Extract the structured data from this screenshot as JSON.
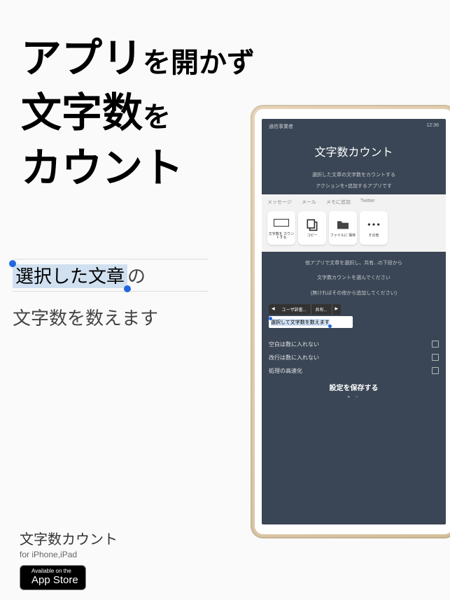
{
  "headline": {
    "l1_big": "アプリ",
    "l1_med": "を開かず",
    "l2_big": "文字数",
    "l2_med": "を",
    "l3_big": "カウント"
  },
  "selection": {
    "highlighted": "選択した文章",
    "after": "の",
    "line2": "文字数を数えます"
  },
  "tablet": {
    "status_left": "通信事業者",
    "status_right": "12:36",
    "title": "文字数カウント",
    "desc1": "選択した文章の文字数をカウントする",
    "desc2": "アクションを+追加するアプリです",
    "share_tabs": [
      "メッセージ",
      "メール",
      "メモに追加",
      "Twitter"
    ],
    "share_icons": [
      {
        "name": "num-count",
        "label": "文字数を\nカウントする"
      },
      {
        "name": "copy",
        "label": "コピー"
      },
      {
        "name": "save-file",
        "label": "ファイルに\n保存"
      },
      {
        "name": "more",
        "label": "その他"
      }
    ],
    "instruct1": "他アプリで文章を選択し、共有...の下段から",
    "instruct2": "文字数カウントを選んでください",
    "instruct3": "(無ければその他から追加してください)",
    "context": [
      "◀",
      "ユーザ辞書...",
      "共有...",
      "▶"
    ],
    "input_text": "選択して文字数を数えます",
    "options": [
      "空白は数に入れない",
      "改行は数に入れない",
      "処理の高速化"
    ],
    "save": "設定を保存する"
  },
  "footer": {
    "title": "文字数カウント",
    "sub": "for iPhone,iPad",
    "badge_top": "Available on the",
    "badge_bottom": "App Store"
  }
}
